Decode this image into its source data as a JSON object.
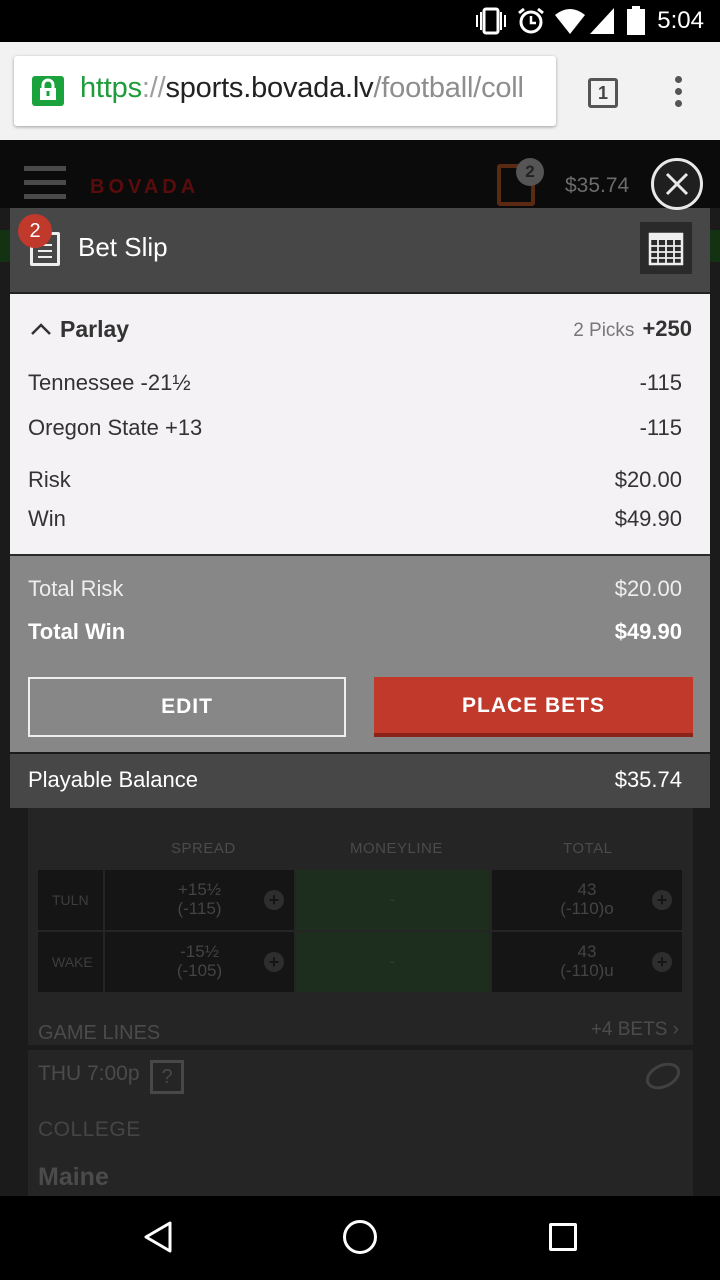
{
  "status_bar": {
    "time": "5:04"
  },
  "browser": {
    "url_scheme": "https",
    "url_sep": "://",
    "url_host": "sports.bovada.lv",
    "url_path": "/football/coll",
    "tab_count": "1"
  },
  "page": {
    "brand": "BOVADA",
    "bet_count": "2",
    "balance": "$35.74",
    "table_headers": {
      "spread": "SPREAD",
      "moneyline": "MONEYLINE",
      "total": "TOTAL"
    },
    "games": [
      {
        "team": "TULN",
        "spread": "+15½",
        "spread_odds": "(-115)",
        "moneyline": "-",
        "total": "43",
        "total_odds": "(-110)o"
      },
      {
        "team": "WAKE",
        "spread": "-15½",
        "spread_odds": "(-105)",
        "moneyline": "-",
        "total": "43",
        "total_odds": "(-110)u"
      }
    ],
    "game_lines_label": "GAME LINES",
    "more_bets": "+4 BETS",
    "next_game": {
      "time": "THU 7:00p",
      "help": "?",
      "league": "COLLEGE",
      "team": "Maine"
    }
  },
  "bet_slip": {
    "badge": "2",
    "title": "Bet Slip",
    "parlay": {
      "label": "Parlay",
      "picks": "2 Picks",
      "odds": "+250"
    },
    "legs": [
      {
        "name": "Tennessee -21½",
        "odds": "-115"
      },
      {
        "name": "Oregon State +13",
        "odds": "-115"
      }
    ],
    "risk_label": "Risk",
    "risk": "$20.00",
    "win_label": "Win",
    "win": "$49.90",
    "total_risk_label": "Total Risk",
    "total_risk": "$20.00",
    "total_win_label": "Total Win",
    "total_win": "$49.90",
    "edit_label": "EDIT",
    "place_label": "PLACE BETS",
    "playable_label": "Playable Balance",
    "playable": "$35.74"
  },
  "colors": {
    "accent_red": "#c0392b",
    "url_green": "#1e9b3a",
    "slip_header": "#474747"
  }
}
